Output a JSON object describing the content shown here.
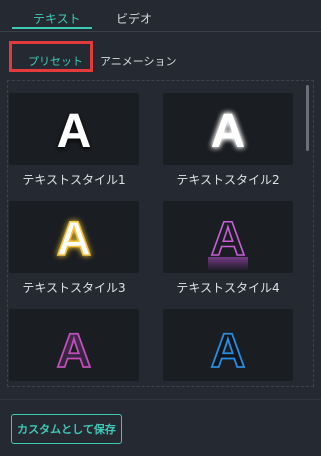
{
  "top_tabs": [
    {
      "label": "テキスト",
      "selected": true
    },
    {
      "label": "ビデオ",
      "selected": false
    }
  ],
  "sub_tabs": [
    {
      "label": "プリセット",
      "selected": true
    },
    {
      "label": "アニメーション",
      "selected": false
    }
  ],
  "presets": [
    {
      "label": "テキストスタイル1",
      "glyph": "A",
      "style": "white-shadow"
    },
    {
      "label": "テキストスタイル2",
      "glyph": "A",
      "style": "white-glow"
    },
    {
      "label": "テキストスタイル3",
      "glyph": "A",
      "style": "yellow-glow"
    },
    {
      "label": "テキストスタイル4",
      "glyph": "A",
      "style": "pink-outline"
    },
    {
      "label": "",
      "glyph": "A",
      "style": "magenta-outline-fill"
    },
    {
      "label": "",
      "glyph": "A",
      "style": "blue-outline"
    }
  ],
  "save_button": {
    "label": "カスタムとして保存"
  },
  "colors": {
    "accent": "#3ec9b7",
    "highlight": "#e33b3b",
    "background": "#252a32"
  }
}
